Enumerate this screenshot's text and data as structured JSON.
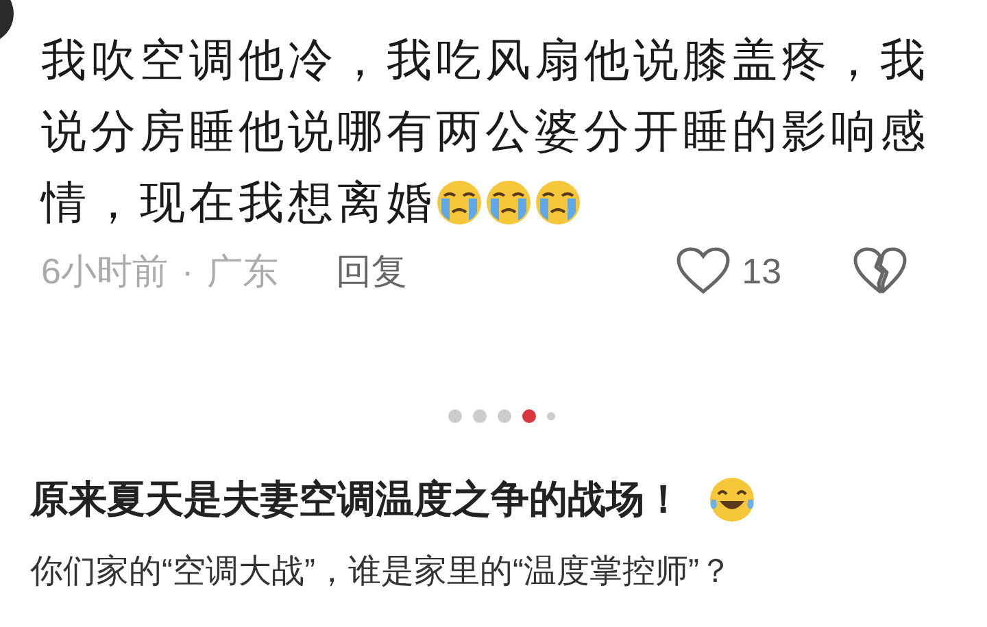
{
  "comment": {
    "lines": [
      "我吹空调他冷，我吃风扇他说膝盖疼，我",
      "说分房睡他说哪有两公婆分开睡的影响感",
      "情，现在我想离婚"
    ],
    "emojis": [
      {
        "kind": "crying"
      },
      {
        "kind": "crying"
      },
      {
        "kind": "crying"
      }
    ],
    "time": "6小时前",
    "separator": "·",
    "location": "广东",
    "reply": "回复",
    "likes": "13"
  },
  "carousel_dots": [
    {
      "kind": "full",
      "selected": false
    },
    {
      "kind": "full",
      "selected": false
    },
    {
      "kind": "full",
      "selected": false
    },
    {
      "kind": "full",
      "selected": true
    },
    {
      "kind": "small",
      "selected": false
    }
  ],
  "caption": {
    "title": "原来夏天是夫妻空调温度之争的战场！",
    "question": "你们家的“空调大战”，谁是家里的“温度掌控师”？"
  }
}
